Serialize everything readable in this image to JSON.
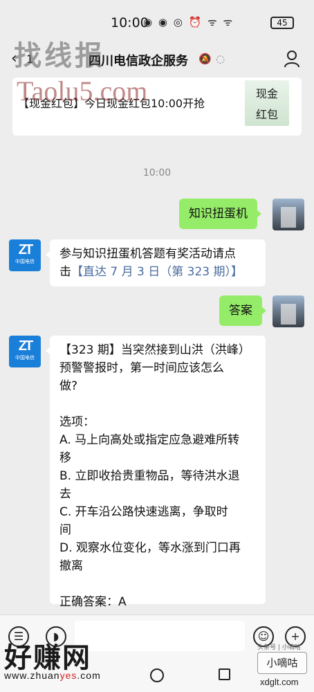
{
  "status_bar": {
    "time": "10:00",
    "icons": "◉ ◉ ◎ ⏰ ᯤ ᯤ",
    "battery": "45"
  },
  "nav": {
    "back_count": "1",
    "title": "四川电信政企服务",
    "mute_icon": "bell-off",
    "ear_icon": "ear"
  },
  "watermarks": {
    "top": "找线报",
    "taolu": "Taolu5.com",
    "site_big": "好赚网",
    "site_url_prefix": "www.zhuan",
    "site_url_red": "yes",
    "site_url_suffix": ".com",
    "xiaodigu": "小嘀咕",
    "xdglt": "xdglt.com",
    "small_top": "头条号 | 小嘀咕"
  },
  "card": {
    "text": "【现金红包】今日现金红包10:00开抢",
    "image_line1": "现金",
    "image_line2": "红包"
  },
  "timestamp": "10:00",
  "messages": [
    {
      "side": "right",
      "text": "知识扭蛋机"
    },
    {
      "side": "left",
      "line1": "参与知识扭蛋机答题有奖活动请点",
      "line2_prefix": "击",
      "link": "【直达 7 月 3 日（第 323 期）】"
    },
    {
      "side": "right",
      "text": "答案"
    },
    {
      "side": "left",
      "lines": [
        "【323 期】当突然接到山洪（洪峰）",
        "预警警报时，第一时间应该怎么",
        "做?",
        "",
        "选项：",
        "A. 马上向高处或指定应急避难所转",
        "移",
        "B. 立即收拾贵重物品，等待洪水退",
        "去",
        "C. 开车沿公路快速逃离，争取时",
        "间",
        "D. 观察水位变化，等水涨到门口再",
        "撤离",
        "",
        "正确答案：A"
      ]
    }
  ],
  "bot_avatar": {
    "logo": "ZT",
    "caption": "中国电信"
  }
}
